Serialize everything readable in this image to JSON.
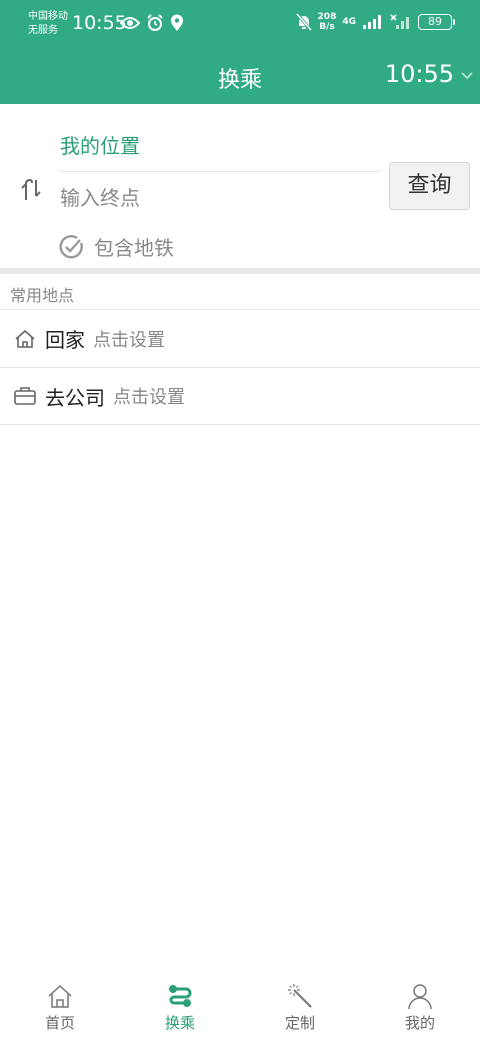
{
  "status_bar": {
    "carrier_line1": "中国移动",
    "carrier_line2": "无服务",
    "time": "10:55",
    "speed_value": "208",
    "speed_unit": "B/s",
    "network": "4G",
    "battery": "89"
  },
  "header": {
    "title": "换乘",
    "time": "10:55"
  },
  "search": {
    "from": "我的位置",
    "to_placeholder": "输入终点",
    "query_button": "查询",
    "subway_option": "包含地铁"
  },
  "places": {
    "section_title": "常用地点",
    "items": [
      {
        "name": "回家",
        "hint": "点击设置",
        "icon": "home-icon"
      },
      {
        "name": "去公司",
        "hint": "点击设置",
        "icon": "briefcase-icon"
      }
    ]
  },
  "nav": {
    "items": [
      {
        "label": "首页",
        "icon": "home-icon",
        "active": false
      },
      {
        "label": "换乘",
        "icon": "transfer-icon",
        "active": true
      },
      {
        "label": "定制",
        "icon": "magic-wand-icon",
        "active": false
      },
      {
        "label": "我的",
        "icon": "person-icon",
        "active": false
      }
    ]
  },
  "colors": {
    "accent": "#31ab86",
    "accent_text": "#2a9f78"
  }
}
